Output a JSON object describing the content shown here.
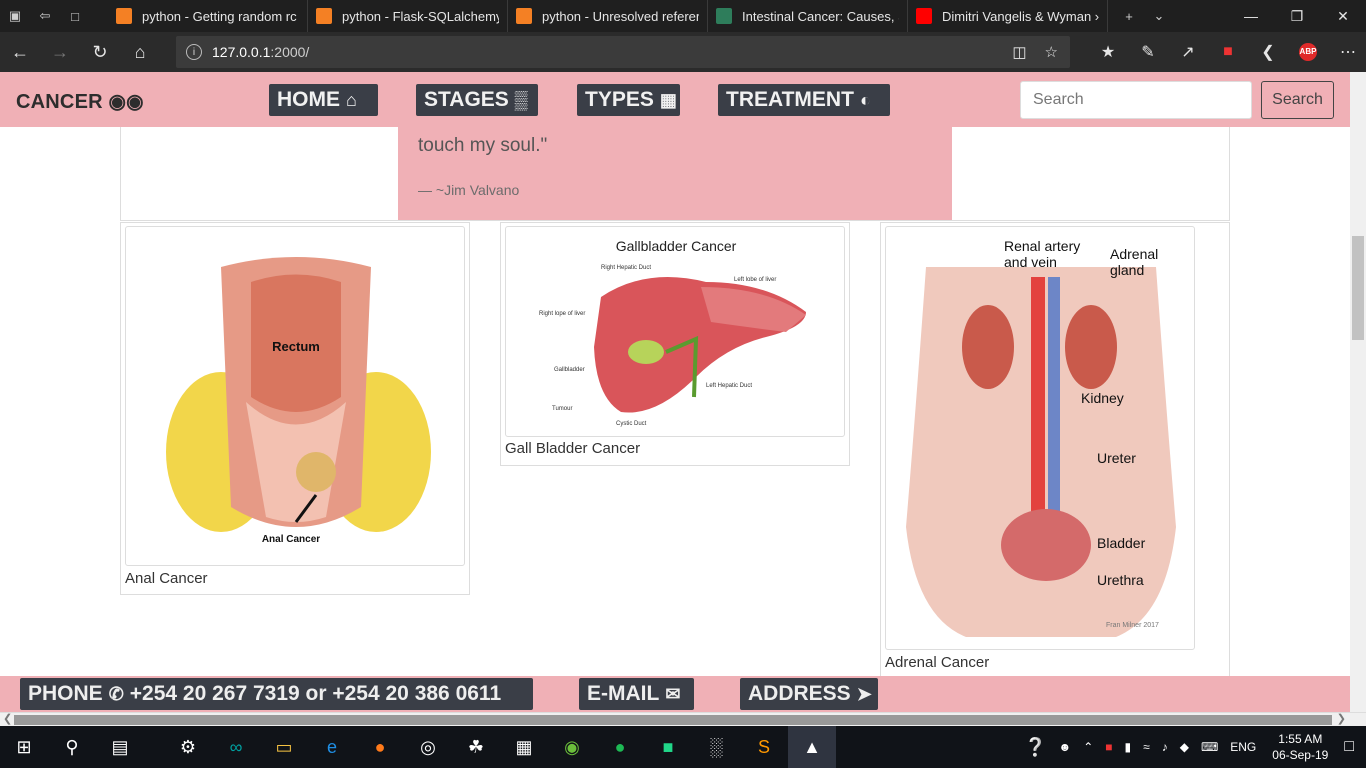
{
  "browser": {
    "tabs": [
      {
        "label": "python - Getting random rc",
        "icon": "stackoverflow-icon",
        "color": "#f48024"
      },
      {
        "label": "python - Flask-SQLalchemy",
        "icon": "stackoverflow-icon",
        "color": "#f48024"
      },
      {
        "label": "python - Unresolved referer",
        "icon": "stackoverflow-icon",
        "color": "#f48024"
      },
      {
        "label": "Intestinal Cancer: Causes, Sy",
        "icon": "site-favicon",
        "color": "#2e7d5b"
      },
      {
        "label": "Dimitri Vangelis & Wyman ›",
        "icon": "youtube-icon",
        "color": "#ff0000"
      }
    ],
    "url_host": "127.0.0.1",
    "url_rest": ":2000/"
  },
  "nav": {
    "brand": "CANCER",
    "items": [
      "HOME",
      "STAGES",
      "TYPES",
      "TREATMENT"
    ],
    "search_placeholder": "Search",
    "search_button": "Search"
  },
  "quote": {
    "text": "touch my soul.\"",
    "author": "— ~Jim Valvano"
  },
  "cards": [
    {
      "caption": "Anal Cancer",
      "img_label_1": "Rectum",
      "img_label_2": "Anal Cancer"
    },
    {
      "caption": "Gall Bladder Cancer",
      "img_title": "Gallbladder Cancer",
      "labels": [
        "Right Hepatic Duct",
        "Left lobe of liver",
        "Right lope of liver",
        "Gallbladder",
        "Left Hepatic Duct",
        "Tumour",
        "Cystic Duct"
      ]
    },
    {
      "caption": "Adrenal Cancer",
      "labels": [
        "Renal artery",
        "and vein",
        "Adrenal",
        "gland",
        "Kidney",
        "Ureter",
        "Bladder",
        "Urethra",
        "Fran Milner 2017"
      ]
    }
  ],
  "footer": {
    "phone_label": "PHONE",
    "phone_numbers": "+254 20 267 7319 or +254 20 386 0611",
    "email_label": "E-MAIL",
    "address_label": "ADDRESS"
  },
  "taskbar": {
    "lang": "ENG",
    "time": "1:55 AM",
    "date": "06-Sep-19"
  }
}
